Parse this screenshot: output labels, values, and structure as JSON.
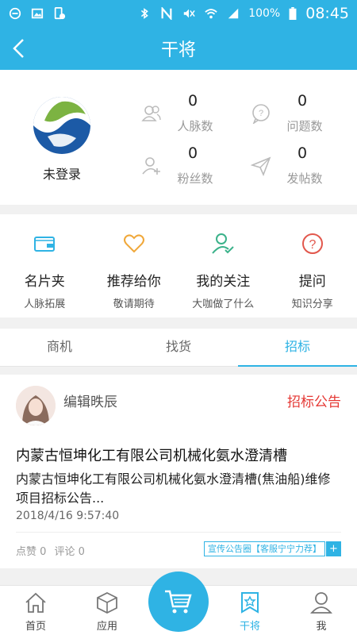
{
  "statusbar": {
    "battery": "100%",
    "time": "08:45"
  },
  "header": {
    "title": "干将"
  },
  "profile": {
    "login_status": "未登录",
    "stats": [
      {
        "value": "0",
        "label": "人脉数",
        "icon": "contacts-icon"
      },
      {
        "value": "0",
        "label": "问题数",
        "icon": "question-bubble-icon"
      },
      {
        "value": "0",
        "label": "粉丝数",
        "icon": "add-user-icon"
      },
      {
        "value": "0",
        "label": "发帖数",
        "icon": "send-icon"
      }
    ]
  },
  "menu": [
    {
      "label": "名片夹",
      "sub": "人脉拓展",
      "icon": "card-holder-icon"
    },
    {
      "label": "推荐给你",
      "sub": "敬请期待",
      "icon": "heart-icon"
    },
    {
      "label": "我的关注",
      "sub": "大咖做了什么",
      "icon": "user-check-icon"
    },
    {
      "label": "提问",
      "sub": "知识分享",
      "icon": "question-icon"
    }
  ],
  "tabs": [
    {
      "label": "商机"
    },
    {
      "label": "找货"
    },
    {
      "label": "招标"
    }
  ],
  "post": {
    "author": "编辑昳辰",
    "tag": "招标公告",
    "title": "内蒙古恒坤化工有限公司机械化氨水澄清槽",
    "description": "内蒙古恒坤化工有限公司机械化氨水澄清槽(焦油船)维修项目招标公告...",
    "time": "2018/4/16 9:57:40",
    "likes": "点赞 0",
    "comments": "评论 0",
    "promo": "宣传公告圈【客服宁宁力荐】",
    "promo_plus": "+"
  },
  "bottom_nav": [
    {
      "label": "首页",
      "icon": "home-icon"
    },
    {
      "label": "应用",
      "icon": "cube-icon"
    },
    {
      "label": "",
      "icon": "cart-icon"
    },
    {
      "label": "干将",
      "icon": "star-tag-icon"
    },
    {
      "label": "我",
      "icon": "person-icon"
    }
  ],
  "colors": {
    "accent": "#2fb3e4",
    "tag_red": "#e53935"
  }
}
